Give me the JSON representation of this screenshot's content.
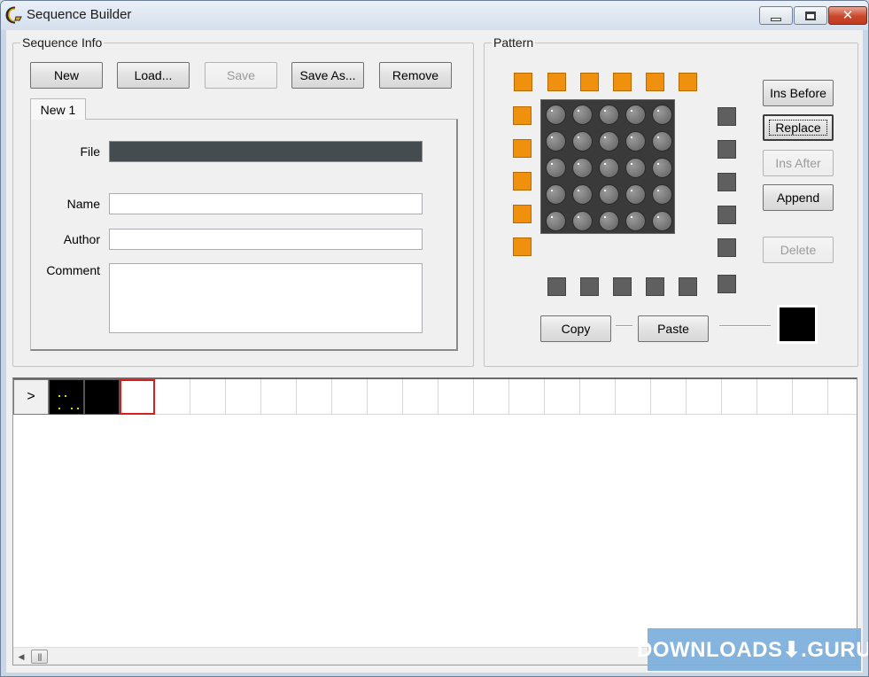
{
  "window": {
    "title": "Sequence Builder",
    "close_glyph": "✕"
  },
  "sequence_info": {
    "legend": "Sequence Info",
    "buttons": {
      "new": "New",
      "load": "Load...",
      "save": "Save",
      "save_as": "Save As...",
      "remove": "Remove"
    },
    "tab": "New 1",
    "fields": {
      "file_label": "File",
      "file_value": "",
      "name_label": "Name",
      "name_value": "",
      "author_label": "Author",
      "author_value": "",
      "comment_label": "Comment",
      "comment_value": ""
    }
  },
  "pattern": {
    "legend": "Pattern",
    "buttons": {
      "ins_before": "Ins Before",
      "replace": "Replace",
      "ins_after": "Ins After",
      "append": "Append",
      "delete": "Delete",
      "copy": "Copy",
      "paste": "Paste"
    },
    "grid_rows": 5,
    "grid_cols": 5,
    "colors": {
      "led_off": "#808080",
      "selector_active": "#f0900f",
      "selector_inactive": "#5f5f5f",
      "current_color": "#000000"
    }
  },
  "timeline": {
    "play_glyph": ">",
    "selected_frame_color": "#d81f1f",
    "scroll_left_glyph": "◀",
    "thumb_glyph": "|||"
  },
  "watermark": {
    "text": "DOWNLOADS⬇.GURU"
  }
}
